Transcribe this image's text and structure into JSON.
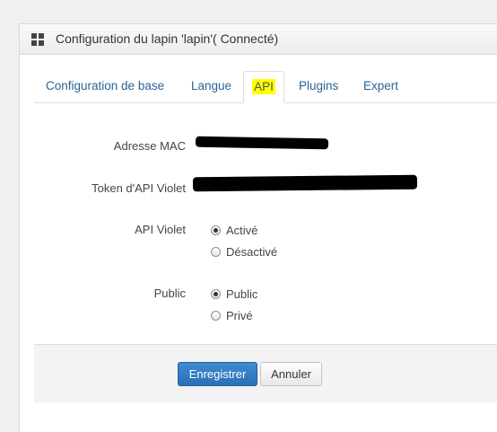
{
  "panel": {
    "icon": "grid-icon",
    "title": "Configuration du lapin 'lapin'( Connecté)"
  },
  "tabs": [
    {
      "label": "Configuration de base",
      "active": false
    },
    {
      "label": "Langue",
      "active": false
    },
    {
      "label": "API",
      "active": true
    },
    {
      "label": "Plugins",
      "active": false
    },
    {
      "label": "Expert",
      "active": false
    }
  ],
  "fields": {
    "mac_label": "Adresse MAC",
    "token_label": "Token d'API Violet",
    "api_violet": {
      "label": "API Violet",
      "options": [
        {
          "label": "Activé",
          "checked": true
        },
        {
          "label": "Désactivé",
          "checked": false
        }
      ]
    },
    "public": {
      "label": "Public",
      "options": [
        {
          "label": "Public",
          "checked": true
        },
        {
          "label": "Privé",
          "checked": false
        }
      ]
    }
  },
  "buttons": {
    "save": "Enregistrer",
    "cancel": "Annuler"
  },
  "colors": {
    "primary": "#337ab7",
    "tab_link": "#2a6496",
    "highlight": "#ffff00"
  }
}
